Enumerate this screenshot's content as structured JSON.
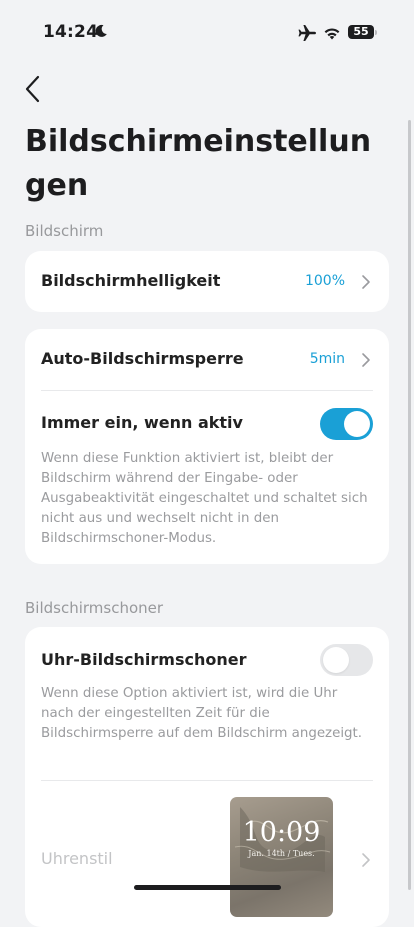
{
  "status_bar": {
    "time": "14:24",
    "battery": "55",
    "icons": [
      "moon-icon",
      "airplane-icon",
      "wifi-icon",
      "battery-icon"
    ]
  },
  "header": {
    "back_icon": "chevron-left-icon",
    "title": "Bildschirmeinstellungen"
  },
  "sections": {
    "display": {
      "label": "Bildschirm",
      "brightness": {
        "label": "Bildschirmhelligkeit",
        "value": "100%"
      },
      "auto_lock": {
        "label": "Auto-Bildschirmsperre",
        "value": "5min"
      },
      "always_on": {
        "label": "Immer ein, wenn aktiv",
        "enabled": true,
        "description": "Wenn diese Funktion aktiviert ist, bleibt der Bildschirm während der Eingabe- oder Ausgabeaktivität eingeschaltet und schaltet sich nicht aus und wechselt nicht in den Bildschirmschoner-Modus."
      }
    },
    "screensaver": {
      "label": "Bildschirmschoner",
      "clock_saver": {
        "label": "Uhr-Bildschirmschoner",
        "enabled": false,
        "description": "Wenn diese Option aktiviert ist, wird die Uhr nach der eingestellten Zeit für die Bildschirmsperre auf dem Bildschirm angezeigt."
      },
      "clock_style": {
        "label": "Uhrenstil",
        "preview_time": "10:09",
        "preview_date": "Jan. 14th / Tues."
      }
    }
  },
  "colors": {
    "accent": "#1aa0d6",
    "background": "#f2f3f5",
    "card": "#ffffff",
    "secondary_text": "#9a9b9e"
  }
}
